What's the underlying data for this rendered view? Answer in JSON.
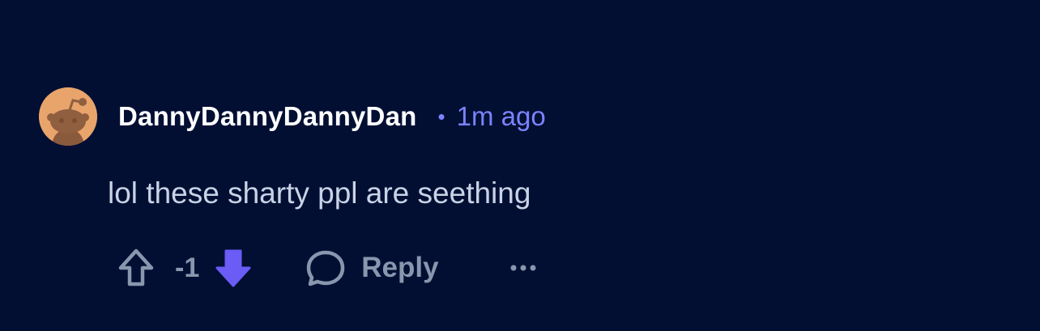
{
  "comment": {
    "author": "DannyDannyDannyDan",
    "separator": "•",
    "timestamp": "1m ago",
    "body": "lol these sharty ppl are seething",
    "score": "-1",
    "reply_label": "Reply",
    "avatar_icon": "reddit-snoo-avatar-icon",
    "more_icon": "more-options-icon"
  },
  "colors": {
    "background": "#020f33",
    "accent": "#7b83ff",
    "downvote_active": "#6a5cf5",
    "muted": "#8a96ad",
    "avatar_bg": "#e9a46b"
  }
}
